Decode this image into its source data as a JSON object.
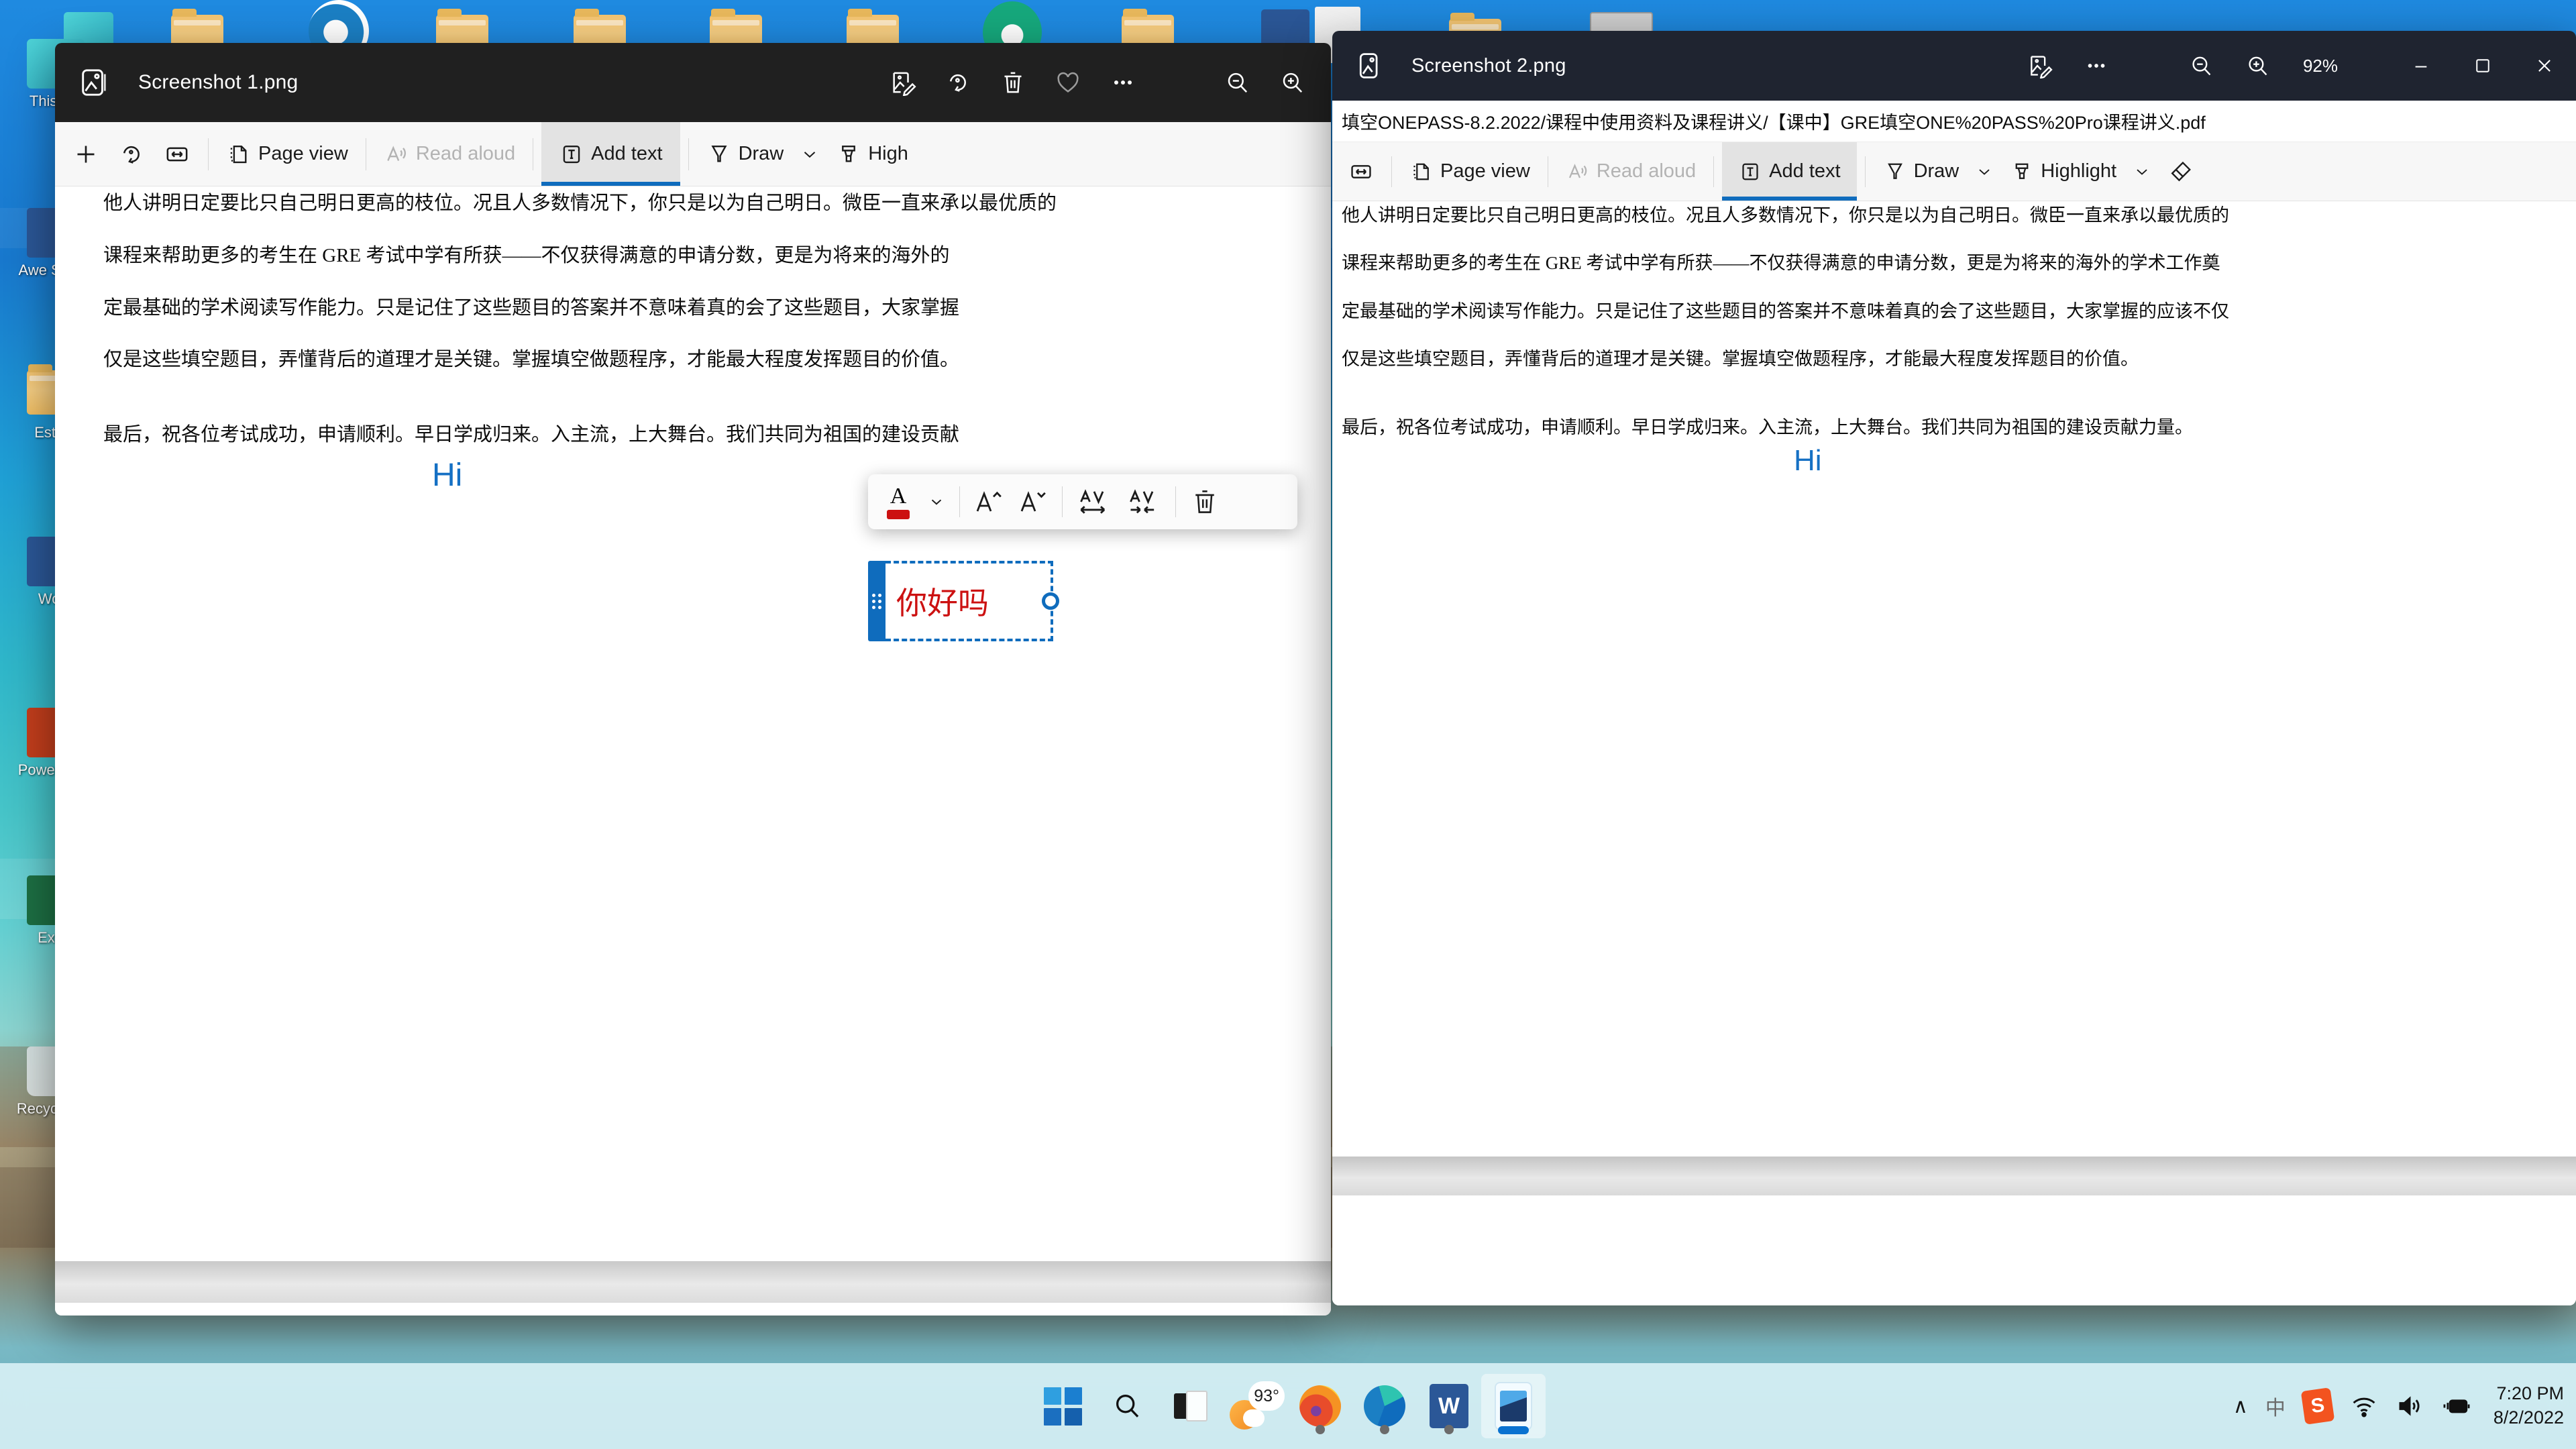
{
  "desktop": {
    "icons_left": [
      {
        "label": "This PC",
        "icon": "this-pc-icon"
      },
      {
        "label": "Awe Speak",
        "icon": "word-doc-icon"
      },
      {
        "label": "Esther",
        "icon": "folder-icon"
      },
      {
        "label": "Word",
        "icon": "word-shortcut-icon"
      },
      {
        "label": "PowerPoint",
        "icon": "powerpoint-shortcut-icon"
      },
      {
        "label": "Excel",
        "icon": "excel-shortcut-icon"
      },
      {
        "label": "Recycle Bin",
        "icon": "recycle-bin-icon"
      }
    ]
  },
  "window1": {
    "title": "Screenshot 1.png",
    "app_icon": "photos-app-icon",
    "titlebar_buttons": [
      {
        "name": "edit-image-icon",
        "label": "Edit image"
      },
      {
        "name": "rotate-icon",
        "label": "Rotate"
      },
      {
        "name": "delete-icon",
        "label": "Delete"
      },
      {
        "name": "favorite-heart-icon",
        "label": "Add to favorites"
      },
      {
        "name": "more-options-icon",
        "label": "See more"
      },
      {
        "name": "zoom-out-icon",
        "label": "Zoom out"
      },
      {
        "name": "zoom-in-icon",
        "label": "Zoom in"
      }
    ],
    "pdf_toolbar": [
      {
        "name": "add-notes-icon",
        "label": "",
        "icon": "plus",
        "state": "normal"
      },
      {
        "name": "rotate-page-icon",
        "label": "",
        "icon": "rotate",
        "state": "normal"
      },
      {
        "name": "fit-to-width-icon",
        "label": "",
        "icon": "fit-width",
        "state": "normal"
      },
      {
        "name": "page-view-button",
        "label": "Page view",
        "icon": "page-view",
        "state": "normal"
      },
      {
        "name": "read-aloud-button",
        "label": "Read aloud",
        "icon": "read-aloud",
        "state": "disabled"
      },
      {
        "name": "add-text-button",
        "label": "Add text",
        "icon": "add-text",
        "state": "active"
      },
      {
        "name": "draw-button",
        "label": "Draw",
        "icon": "pen",
        "state": "normal",
        "has_chevron": true
      },
      {
        "name": "highlight-button",
        "label": "High",
        "icon": "highlighter",
        "state": "normal"
      }
    ],
    "document": {
      "lines": [
        "他人讲明日定要比只自己明日更高的枝位。况且人多数情况下，你只是以为自己明日。微臣一直来承以最优质的",
        "课程来帮助更多的考生在  GRE  考试中学有所获——不仅获得满意的申请分数，更是为将来的海外的",
        "定最基础的学术阅读写作能力。只是记住了这些题目的答案并不意味着真的会了这些题目，大家掌握",
        "仅是这些填空题目，弄懂背后的道理才是关键。掌握填空做题程序，才能最大程度发挥题目的价值。",
        "最后，祝各位考试成功，申请顺利。早日学成归来。入主流，上大舞台。我们共同为祖国的建设贡献"
      ],
      "annotation_hi": "Hi"
    },
    "format_toolbar": [
      {
        "name": "font-color-button",
        "label": "A",
        "color": "#cc1111"
      },
      {
        "name": "font-color-chevron-icon",
        "label": ""
      },
      {
        "name": "increase-font-size-button",
        "label": "A"
      },
      {
        "name": "decrease-font-size-button",
        "label": "A"
      },
      {
        "name": "increase-spacing-button",
        "label": "AV"
      },
      {
        "name": "decrease-spacing-button",
        "label": "AV"
      },
      {
        "name": "delete-text-button",
        "label": ""
      }
    ],
    "textbox": {
      "value": "你好吗",
      "text_color": "#cc1111",
      "selection_color": "#0f6cbd"
    }
  },
  "window2": {
    "title": "Screenshot 2.png",
    "app_icon": "photos-app-icon",
    "zoom_level": "92%",
    "titlebar_buttons": [
      {
        "name": "edit-image-icon",
        "label": "Edit image"
      },
      {
        "name": "more-options-icon",
        "label": "See more"
      },
      {
        "name": "zoom-out-icon",
        "label": "Zoom out"
      },
      {
        "name": "zoom-in-icon",
        "label": "Zoom in"
      }
    ],
    "window_controls": [
      {
        "name": "minimize-button",
        "label": "–"
      },
      {
        "name": "maximize-button",
        "label": "☐"
      },
      {
        "name": "close-button",
        "label": "✕"
      }
    ],
    "address": "填空ONEPASS-8.2.2022/课程中使用资料及课程讲义/【课中】GRE填空ONE%20PASS%20Pro课程讲义.pdf",
    "pdf_toolbar": [
      {
        "name": "fit-to-width-icon",
        "label": "",
        "icon": "fit-width",
        "state": "normal"
      },
      {
        "name": "page-view-button",
        "label": "Page view",
        "icon": "page-view",
        "state": "normal"
      },
      {
        "name": "read-aloud-button",
        "label": "Read aloud",
        "icon": "read-aloud",
        "state": "disabled"
      },
      {
        "name": "add-text-button",
        "label": "Add text",
        "icon": "add-text",
        "state": "active"
      },
      {
        "name": "draw-button",
        "label": "Draw",
        "icon": "pen",
        "state": "normal",
        "has_chevron": true
      },
      {
        "name": "highlight-button",
        "label": "Highlight",
        "icon": "highlighter",
        "state": "normal",
        "has_chevron": true
      },
      {
        "name": "erase-button",
        "label": "",
        "icon": "eraser",
        "state": "normal"
      }
    ],
    "document": {
      "lines": [
        "他人讲明日定要比只自己明日更高的枝位。况且人多数情况下，你只是以为自己明日。微臣一直来承以最优质的",
        "课程来帮助更多的考生在  GRE  考试中学有所获——不仅获得满意的申请分数，更是为将来的海外的学术工作奠",
        "定最基础的学术阅读写作能力。只是记住了这些题目的答案并不意味着真的会了这些题目，大家掌握的应该不仅",
        "仅是这些填空题目，弄懂背后的道理才是关键。掌握填空做题程序，才能最大程度发挥题目的价值。",
        "最后，祝各位考试成功，申请顺利。早日学成归来。入主流，上大舞台。我们共同为祖国的建设贡献力量。"
      ],
      "annotation_hi": "Hi"
    }
  },
  "taskbar": {
    "apps": [
      {
        "name": "start-button",
        "label": "Start"
      },
      {
        "name": "search-button",
        "label": "Search"
      },
      {
        "name": "task-view-button",
        "label": "Task view"
      },
      {
        "name": "weather-widget",
        "label": "93°"
      },
      {
        "name": "firefox-taskbar-icon",
        "label": "Firefox",
        "running": true
      },
      {
        "name": "edge-taskbar-icon",
        "label": "Microsoft Edge",
        "running": true
      },
      {
        "name": "word-taskbar-icon",
        "label": "Word",
        "running": true
      },
      {
        "name": "photos-taskbar-icon",
        "label": "Photos",
        "active": true
      }
    ],
    "tray": [
      {
        "name": "show-hidden-icons-button",
        "label": "∧"
      },
      {
        "name": "ime-language-icon",
        "label": "中"
      },
      {
        "name": "sogou-ime-icon",
        "label": "S"
      },
      {
        "name": "wifi-icon",
        "label": "Network"
      },
      {
        "name": "volume-icon",
        "label": "Volume"
      },
      {
        "name": "battery-charging-icon",
        "label": "Battery"
      }
    ],
    "clock": {
      "time": "7:20 PM",
      "date": "8/2/2022"
    }
  }
}
